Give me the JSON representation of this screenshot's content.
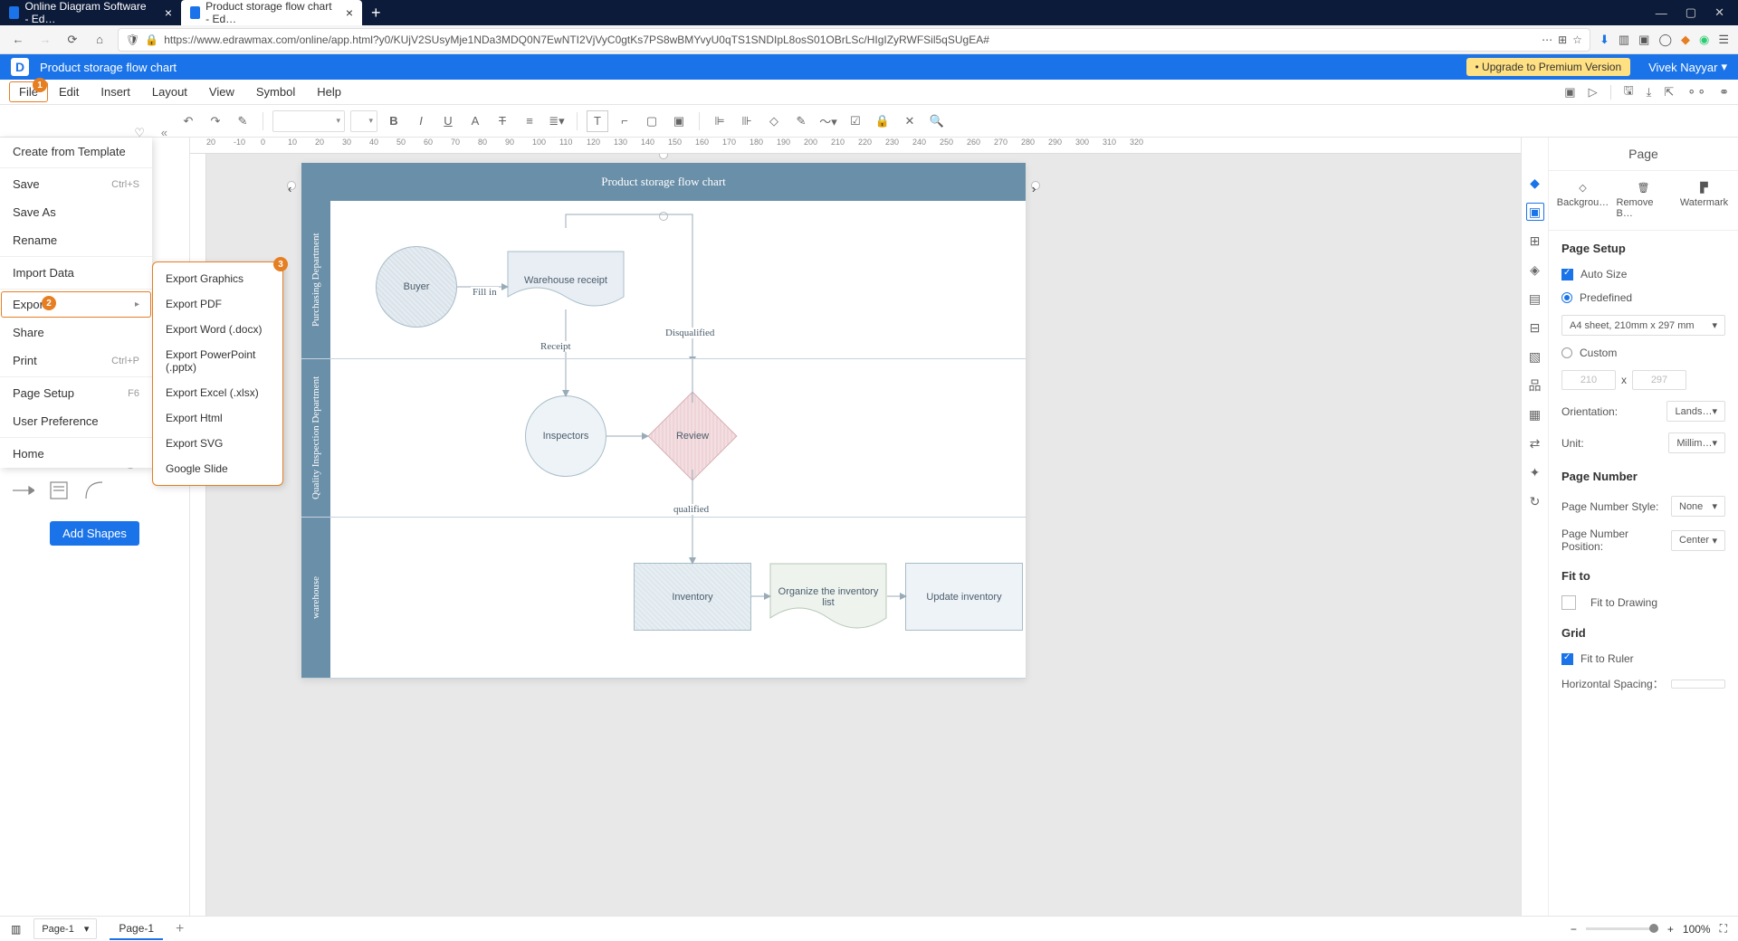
{
  "browser": {
    "tabs": [
      {
        "title": "Online Diagram Software - Ed…",
        "active": false
      },
      {
        "title": "Product storage flow chart - Ed…",
        "active": true
      }
    ],
    "url": "https://www.edrawmax.com/online/app.html?y0/KUjV2SUsyMje1NDa3MDQ0N7EwNTI2VjVyC0gtKs7PS8wBMYvyU0qTS1SNDIpL8osS01OBrLSc/HIgIZyRWFSil5qSUgEA#"
  },
  "app": {
    "title": "Product storage flow chart",
    "upgrade": "• Upgrade to Premium Version",
    "user": "Vivek Nayyar"
  },
  "menubar": [
    "File",
    "Edit",
    "Insert",
    "Layout",
    "View",
    "Symbol",
    "Help"
  ],
  "fileMenu": {
    "items": [
      {
        "label": "Create from Template"
      },
      {
        "label": "Save",
        "shortcut": "Ctrl+S"
      },
      {
        "label": "Save As"
      },
      {
        "label": "Rename"
      },
      {
        "label": "Import Data"
      },
      {
        "label": "Export",
        "submenu": true,
        "highlighted": true
      },
      {
        "label": "Share"
      },
      {
        "label": "Print",
        "shortcut": "Ctrl+P"
      },
      {
        "label": "Page Setup",
        "shortcut": "F6"
      },
      {
        "label": "User Preference"
      },
      {
        "label": "Home"
      }
    ]
  },
  "exportMenu": [
    "Export Graphics",
    "Export PDF",
    "Export Word (.docx)",
    "Export PowerPoint (.pptx)",
    "Export Excel (.xlsx)",
    "Export Html",
    "Export SVG",
    "Google Slide"
  ],
  "callouts": {
    "file": "1",
    "export": "2",
    "graphics": "3"
  },
  "diagram": {
    "title": "Product storage flow chart",
    "lanes": [
      "Purchasing Department",
      "Quality Inspection Department",
      "warehouse"
    ],
    "nodes": {
      "buyer": "Buyer",
      "warehouseReceipt": "Warehouse receipt",
      "inspectors": "Inspectors",
      "review": "Review",
      "inventory": "Inventory",
      "organize": "Organize the inventory list",
      "update": "Update inventory"
    },
    "edges": {
      "fillIn": "Fill in",
      "receipt": "Receipt",
      "disqualified": "Disqualified",
      "qualified": "qualified"
    }
  },
  "left": {
    "addShapes": "Add Shapes"
  },
  "rulerH": [
    "20",
    "-10",
    "0",
    "10",
    "20",
    "30",
    "40",
    "50",
    "60",
    "70",
    "80",
    "90",
    "100",
    "110",
    "120",
    "130",
    "140",
    "150",
    "160",
    "170",
    "180",
    "190",
    "200",
    "210",
    "220",
    "230",
    "240",
    "250",
    "260",
    "270",
    "280",
    "290",
    "300",
    "310",
    "320"
  ],
  "right": {
    "header": "Page",
    "bgActions": [
      "Backgrou…",
      "Remove B…",
      "Watermark"
    ],
    "pageSetup": "Page Setup",
    "autoSize": "Auto Size",
    "predefined": "Predefined",
    "sheet": "A4 sheet, 210mm x 297 mm",
    "custom": "Custom",
    "dimW": "210",
    "dimX": "x",
    "dimH": "297",
    "orientation": "Orientation:",
    "orientationVal": "Lands…",
    "unit": "Unit:",
    "unitVal": "Millim…",
    "pageNumber": "Page Number",
    "pnStyle": "Page Number Style:",
    "pnStyleVal": "None",
    "pnPos": "Page Number Position:",
    "pnPosVal": "Center",
    "fitTo": "Fit to",
    "fitDrawing": "Fit to Drawing",
    "grid": "Grid",
    "fitRuler": "Fit to Ruler",
    "hSpacing": "Horizontal Spacing："
  },
  "status": {
    "pageSelect": "Page-1",
    "pageTab": "Page-1",
    "zoom": "100%"
  }
}
